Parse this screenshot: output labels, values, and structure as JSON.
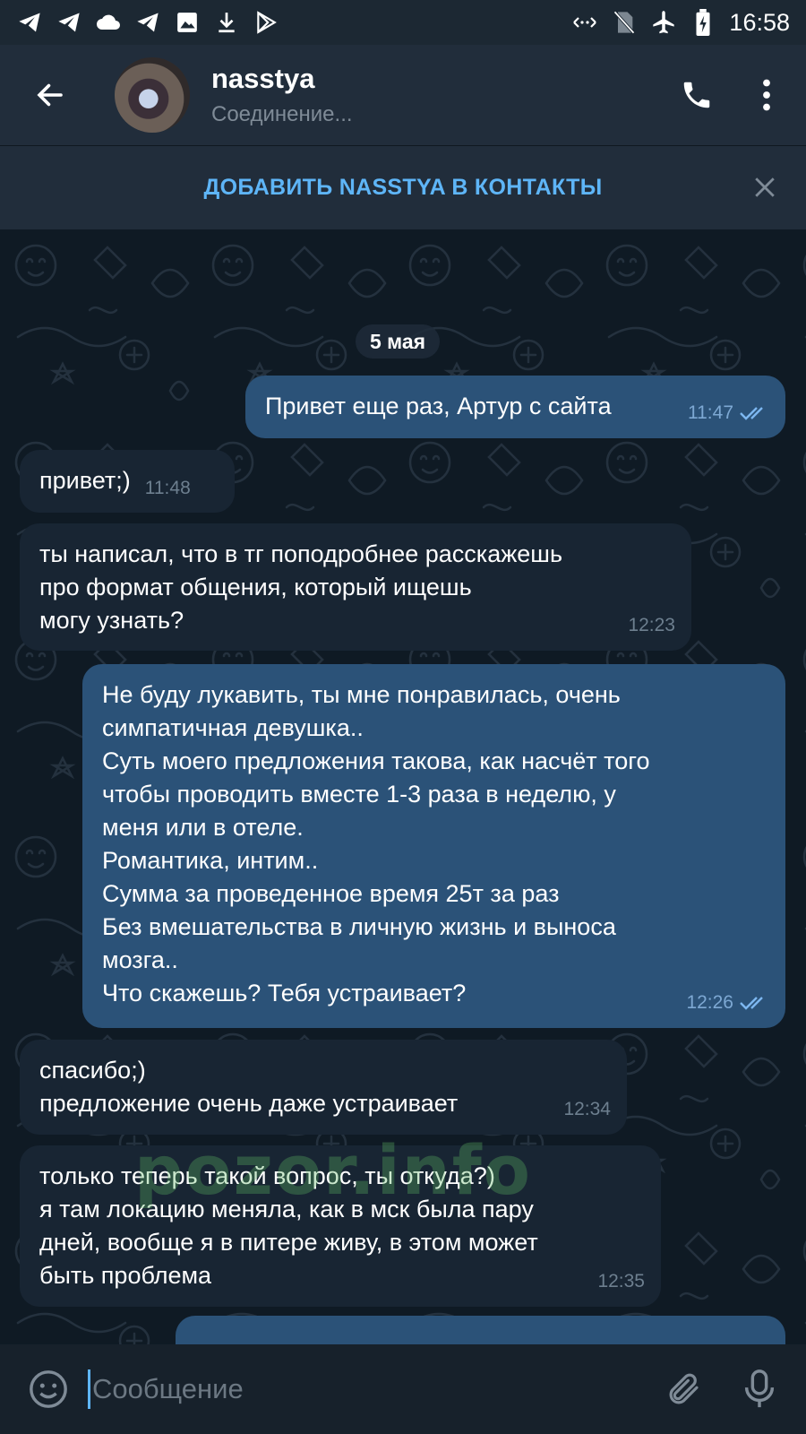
{
  "status_bar": {
    "time": "16:58",
    "left_icons": [
      "telegram-icon",
      "telegram-icon",
      "cloud-icon",
      "telegram-icon",
      "image-icon",
      "download-icon",
      "play-store-icon"
    ],
    "right_icons": [
      "data-saver-icon",
      "no-sim-icon",
      "airplane-icon",
      "battery-charging-icon"
    ]
  },
  "header": {
    "name": "nasstya",
    "status": "Соединение..."
  },
  "add_contact": {
    "label": "ДОБАВИТЬ NASSTYA В КОНТАКТЫ"
  },
  "chat": {
    "date": "5 мая",
    "watermark": "pozor.info",
    "messages": [
      {
        "dir": "out",
        "text": "Привет еще раз, Артур с сайта",
        "time": "11:47",
        "read": true
      },
      {
        "dir": "in",
        "text": "привет;)",
        "time": "11:48"
      },
      {
        "dir": "in",
        "text": "ты написал, что в тг поподробнее расскажешь\nпро формат общения, который ищешь\nмогу узнать?",
        "time": "12:23"
      },
      {
        "dir": "out",
        "text": "Не буду лукавить, ты мне понравилась, очень\nсимпатичная девушка..\nСуть моего предложения такова, как насчёт того\nчтобы проводить вместе 1-3 раза в неделю, у\nменя или в отеле.\nРомантика, интим..\nСумма за проведенное время 25т за раз\nБез вмешательства в личную жизнь и выноса\nмозга..\nЧто скажешь? Тебя устраивает?",
        "time": "12:26",
        "read": true
      },
      {
        "dir": "in",
        "text": "спасибо;)\nпредложение очень даже устраивает",
        "time": "12:34"
      },
      {
        "dir": "in",
        "text": "только теперь такой вопрос,  ты откуда?)\nя там локацию меняла, как в мск была пару\nдней, вообще я в питере живу, в этом может\nбыть проблема",
        "time": "12:35"
      }
    ]
  },
  "input": {
    "placeholder": "Сообщение"
  },
  "colors": {
    "accent": "#5eb5f7",
    "outgoing_bubble": "#2b5278",
    "incoming_bubble": "#182533",
    "header": "#212d3b"
  }
}
